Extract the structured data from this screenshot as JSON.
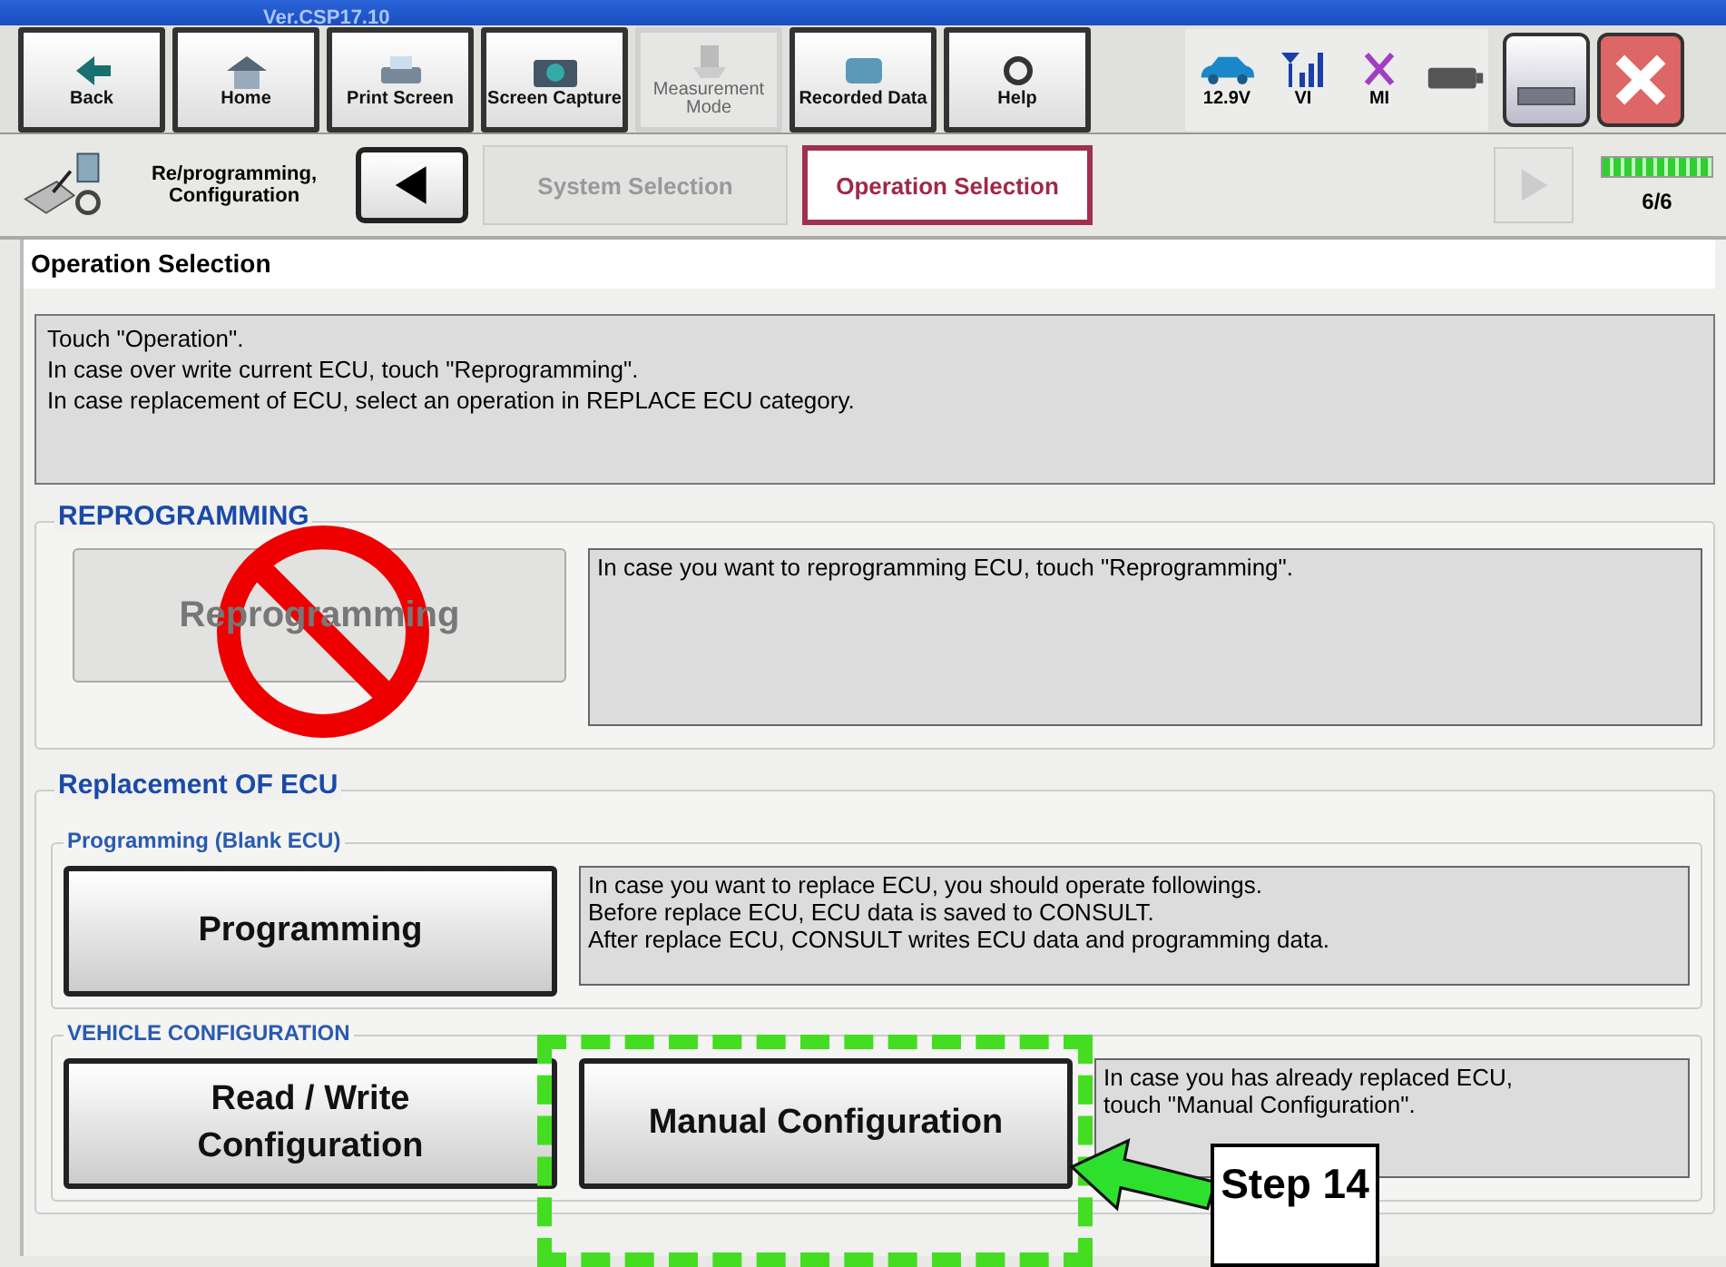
{
  "window": {
    "title": "Ver.CSP17.10"
  },
  "toolbar": [
    {
      "kind": "back",
      "label": "Back",
      "disabled": false
    },
    {
      "kind": "home",
      "label": "Home",
      "disabled": false
    },
    {
      "kind": "print",
      "label": "Print Screen",
      "disabled": false
    },
    {
      "kind": "camera",
      "label": "Screen Capture",
      "disabled": false
    },
    {
      "kind": "measure",
      "label": "Measurement Mode",
      "disabled": true
    },
    {
      "kind": "recorded",
      "label": "Recorded Data",
      "disabled": false
    },
    {
      "kind": "help",
      "label": "Help",
      "disabled": false
    }
  ],
  "status": [
    {
      "kind": "car",
      "label": "12.9V"
    },
    {
      "kind": "signal",
      "label": "VI"
    },
    {
      "kind": "cross",
      "label": "MI"
    },
    {
      "kind": "battery"
    }
  ],
  "breadcrumb": {
    "app": "Re/programming, Configuration",
    "steps": [
      {
        "label": "System Selection",
        "selected": false
      },
      {
        "label": "Operation Selection",
        "selected": true
      }
    ],
    "progress": "6/6",
    "level": 1
  },
  "section_title": "Operation Selection",
  "instructions": [
    "Touch  \"Operation\".",
    "In case over write current ECU, touch \"Reprogramming\".",
    "In case replacement of ECU, select an operation in REPLACE ECU category."
  ],
  "reprogramming": {
    "heading": "REPROGRAMMING",
    "button": {
      "label": "Reprogramming",
      "disabled": true
    },
    "description": [
      "In case you want to reprogramming ECU, touch \"Reprogramming\"."
    ]
  },
  "replacement": {
    "heading": "Replacement OF ECU",
    "groups": [
      {
        "title": "Programming (Blank ECU)",
        "buttons": [
          {
            "label": "Programming",
            "disabled": false
          }
        ],
        "description": [
          "In case you want to replace ECU, you should operate followings.",
          "Before replace ECU, ECU data is saved to CONSULT.",
          "After replace ECU, CONSULT writes ECU data and programming data."
        ]
      },
      {
        "title": "VEHICLE CONFIGURATION",
        "buttons": [
          {
            "label": "Read / Write Configuration",
            "disabled": false
          },
          {
            "label": "Manual Configuration",
            "disabled": false
          }
        ],
        "description": [
          "In case you has already replaced ECU,",
          "touch \"Manual Configuration\"."
        ]
      }
    ]
  },
  "callout": {
    "label": "Step 14"
  }
}
